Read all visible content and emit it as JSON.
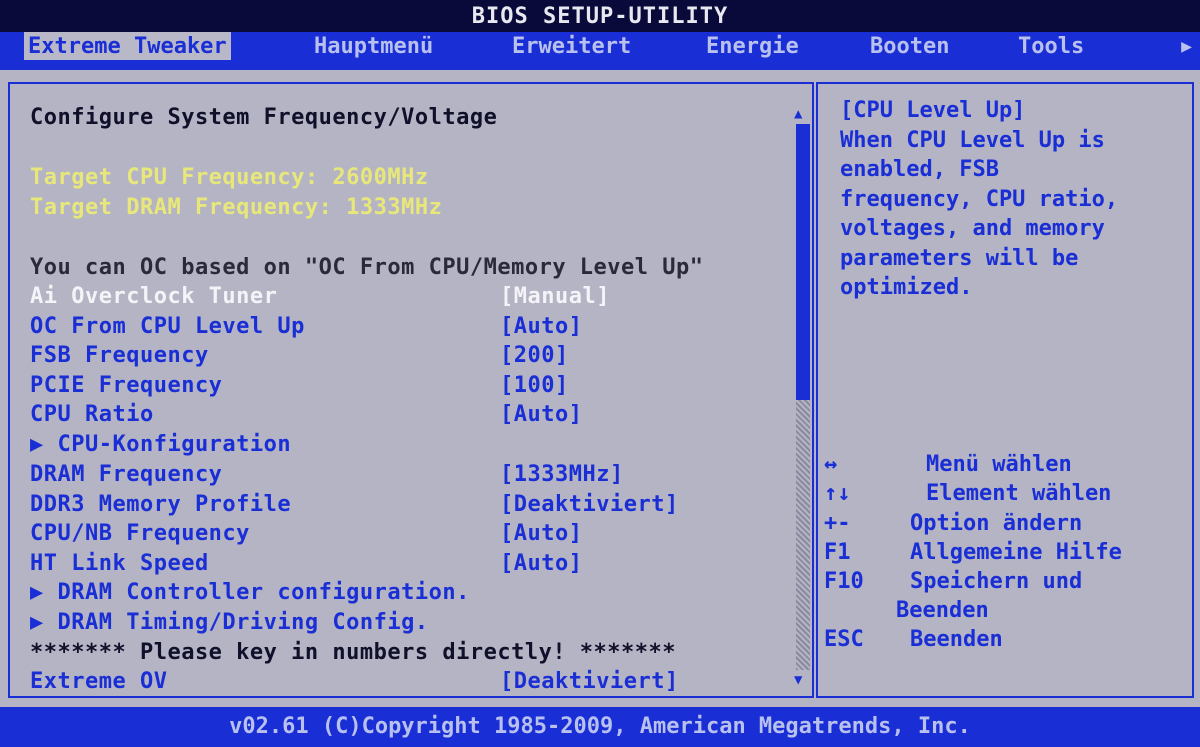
{
  "title": "BIOS SETUP-UTILITY",
  "tabs": [
    {
      "label": "Extreme Tweaker"
    },
    {
      "label": "Hauptmenü"
    },
    {
      "label": "Erweitert"
    },
    {
      "label": "Energie"
    },
    {
      "label": "Booten"
    },
    {
      "label": "Tools"
    }
  ],
  "menu_more_icon": "right-triangle-icon",
  "main": {
    "heading": "Configure System Frequency/Voltage",
    "target_cpu": "Target CPU Frequency: 2600MHz",
    "target_dram": "Target DRAM Frequency: 1333MHz",
    "oc_note": "You can OC based on \"OC From CPU/Memory Level Up\"",
    "settings": [
      {
        "label": "Ai Overclock Tuner",
        "value": "[Manual]"
      },
      {
        "label": "OC From CPU Level Up",
        "value": "[Auto]"
      },
      {
        "label": "FSB Frequency",
        "value": "[200]"
      },
      {
        "label": "PCIE Frequency",
        "value": "[100]"
      },
      {
        "label": "CPU Ratio",
        "value": "[Auto]"
      },
      {
        "label": "▶ CPU-Konfiguration",
        "value": ""
      },
      {
        "label": "DRAM Frequency",
        "value": "[1333MHz]"
      },
      {
        "label": "DDR3 Memory Profile",
        "value": "[Deaktiviert]"
      },
      {
        "label": "CPU/NB Frequency",
        "value": "[Auto]"
      },
      {
        "label": "HT Link Speed",
        "value": "[Auto]"
      },
      {
        "label": "▶ DRAM Controller configuration.",
        "value": ""
      },
      {
        "label": "▶ DRAM Timing/Driving Config.",
        "value": ""
      }
    ],
    "key_note": "******* Please key in numbers directly! *******",
    "extreme_ov": {
      "label": "Extreme OV",
      "value": "[Deaktiviert]"
    }
  },
  "help": {
    "lines": [
      "[CPU Level Up]",
      "When CPU Level Up is",
      "enabled, FSB",
      "frequency, CPU ratio,",
      "voltages, and memory",
      "parameters will be",
      "optimized."
    ]
  },
  "keys": [
    {
      "key": "↔",
      "desc": "Menü wählen"
    },
    {
      "key": "↑↓",
      "desc": "Element wählen"
    },
    {
      "key": "+-",
      "desc": "Option ändern"
    },
    {
      "key": "F1",
      "desc": "Allgemeine Hilfe"
    },
    {
      "key": "F10",
      "desc": "Speichern und"
    },
    {
      "key": "",
      "desc": "Beenden"
    },
    {
      "key": "ESC",
      "desc": "Beenden"
    }
  ],
  "footer": "v02.61 (C)Copyright 1985-2009, American Megatrends, Inc."
}
